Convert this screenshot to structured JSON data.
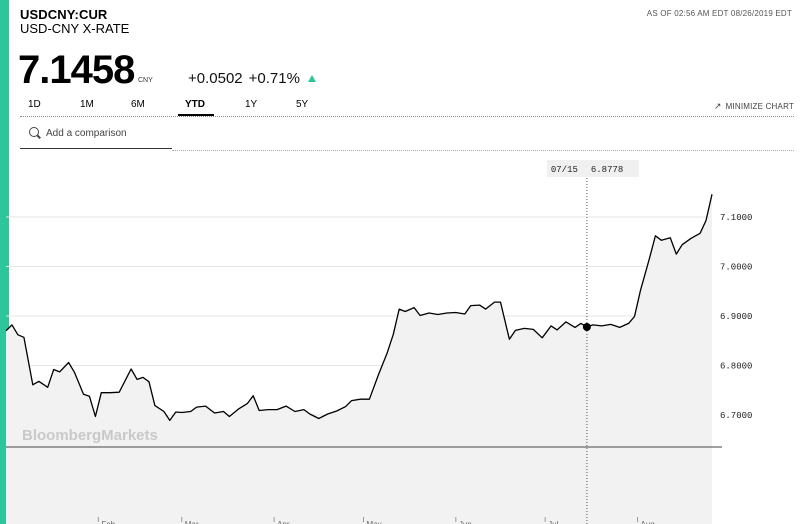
{
  "header": {
    "ticker": "USDCNY:CUR",
    "name": "USD-CNY X-RATE",
    "as_of": "AS OF 02:56 AM EDT 08/26/2019 EDT"
  },
  "quote": {
    "price": "7.1458",
    "currency": "CNY",
    "change": "+0.0502",
    "change_pct": "+0.71%"
  },
  "tabs": [
    {
      "label": "1D",
      "active": false
    },
    {
      "label": "1M",
      "active": false
    },
    {
      "label": "6M",
      "active": false
    },
    {
      "label": "YTD",
      "active": true
    },
    {
      "label": "1Y",
      "active": false
    },
    {
      "label": "5Y",
      "active": false
    }
  ],
  "minimize_label": "MINIMIZE CHART",
  "search": {
    "placeholder": "Add a comparison"
  },
  "watermark": "BloombergMarkets",
  "colors": {
    "accent": "#2ec59b",
    "line": "#000000",
    "fill": "#f2f2f2"
  },
  "chart_data": {
    "type": "area",
    "y_ticks": [
      "7.1000",
      "7.0000",
      "6.9000",
      "6.8000",
      "6.7000"
    ],
    "y_tick_values": [
      7.1,
      7.0,
      6.9,
      6.8,
      6.7
    ],
    "ylim": [
      6.6371,
      7.1864
    ],
    "x_tick_labels": [
      "Feb",
      "Mar",
      "Apr",
      "May",
      "Jun",
      "Jul",
      "Aug"
    ],
    "x_range": [
      "2019-01-01",
      "2019-08-26"
    ],
    "grid": true,
    "crosshair": {
      "x": "2019-07-15",
      "label_date": "07/15",
      "label_value": "6.8778",
      "value": 6.8778
    },
    "series": [
      {
        "values": [
          [
            "2019-01-01",
            6.87
          ],
          [
            "2019-01-03",
            6.882
          ],
          [
            "2019-01-05",
            6.862
          ],
          [
            "2019-01-07",
            6.857
          ],
          [
            "2019-01-10",
            6.761
          ],
          [
            "2019-01-12",
            6.768
          ],
          [
            "2019-01-15",
            6.756
          ],
          [
            "2019-01-17",
            6.792
          ],
          [
            "2019-01-19",
            6.787
          ],
          [
            "2019-01-22",
            6.806
          ],
          [
            "2019-01-24",
            6.786
          ],
          [
            "2019-01-27",
            6.742
          ],
          [
            "2019-01-29",
            6.738
          ],
          [
            "2019-01-31",
            6.697
          ],
          [
            "2019-02-02",
            6.745
          ],
          [
            "2019-02-05",
            6.745
          ],
          [
            "2019-02-08",
            6.746
          ],
          [
            "2019-02-12",
            6.793
          ],
          [
            "2019-02-14",
            6.772
          ],
          [
            "2019-02-16",
            6.776
          ],
          [
            "2019-02-18",
            6.767
          ],
          [
            "2019-02-20",
            6.719
          ],
          [
            "2019-02-23",
            6.707
          ],
          [
            "2019-02-25",
            6.689
          ],
          [
            "2019-02-27",
            6.706
          ],
          [
            "2019-03-01",
            6.705
          ],
          [
            "2019-03-04",
            6.707
          ],
          [
            "2019-03-06",
            6.716
          ],
          [
            "2019-03-09",
            6.718
          ],
          [
            "2019-03-12",
            6.704
          ],
          [
            "2019-03-15",
            6.707
          ],
          [
            "2019-03-17",
            6.697
          ],
          [
            "2019-03-20",
            6.712
          ],
          [
            "2019-03-23",
            6.723
          ],
          [
            "2019-03-25",
            6.739
          ],
          [
            "2019-03-27",
            6.709
          ],
          [
            "2019-03-30",
            6.711
          ],
          [
            "2019-04-02",
            6.711
          ],
          [
            "2019-04-05",
            6.718
          ],
          [
            "2019-04-08",
            6.707
          ],
          [
            "2019-04-11",
            6.711
          ],
          [
            "2019-04-13",
            6.702
          ],
          [
            "2019-04-16",
            6.693
          ],
          [
            "2019-04-19",
            6.702
          ],
          [
            "2019-04-22",
            6.708
          ],
          [
            "2019-04-25",
            6.717
          ],
          [
            "2019-04-27",
            6.729
          ],
          [
            "2019-04-30",
            6.732
          ],
          [
            "2019-05-03",
            6.732
          ],
          [
            "2019-05-06",
            6.781
          ],
          [
            "2019-05-09",
            6.826
          ],
          [
            "2019-05-11",
            6.863
          ],
          [
            "2019-05-13",
            6.914
          ],
          [
            "2019-05-15",
            6.909
          ],
          [
            "2019-05-18",
            6.917
          ],
          [
            "2019-05-20",
            6.901
          ],
          [
            "2019-05-23",
            6.906
          ],
          [
            "2019-05-26",
            6.903
          ],
          [
            "2019-05-29",
            6.906
          ],
          [
            "2019-06-01",
            6.907
          ],
          [
            "2019-06-04",
            6.904
          ],
          [
            "2019-06-06",
            6.921
          ],
          [
            "2019-06-09",
            6.922
          ],
          [
            "2019-06-11",
            6.914
          ],
          [
            "2019-06-14",
            6.928
          ],
          [
            "2019-06-16",
            6.928
          ],
          [
            "2019-06-19",
            6.853
          ],
          [
            "2019-06-21",
            6.871
          ],
          [
            "2019-06-24",
            6.875
          ],
          [
            "2019-06-27",
            6.873
          ],
          [
            "2019-06-30",
            6.856
          ],
          [
            "2019-07-03",
            6.88
          ],
          [
            "2019-07-05",
            6.872
          ],
          [
            "2019-07-08",
            6.888
          ],
          [
            "2019-07-11",
            6.877
          ],
          [
            "2019-07-13",
            6.885
          ],
          [
            "2019-07-15",
            6.8778
          ],
          [
            "2019-07-17",
            6.882
          ],
          [
            "2019-07-20",
            6.88
          ],
          [
            "2019-07-23",
            6.883
          ],
          [
            "2019-07-26",
            6.877
          ],
          [
            "2019-07-29",
            6.885
          ],
          [
            "2019-07-31",
            6.899
          ],
          [
            "2019-08-02",
            6.952
          ],
          [
            "2019-08-05",
            7.016
          ],
          [
            "2019-08-07",
            7.062
          ],
          [
            "2019-08-09",
            7.053
          ],
          [
            "2019-08-12",
            7.058
          ],
          [
            "2019-08-14",
            7.025
          ],
          [
            "2019-08-16",
            7.044
          ],
          [
            "2019-08-19",
            7.057
          ],
          [
            "2019-08-22",
            7.067
          ],
          [
            "2019-08-24",
            7.093
          ],
          [
            "2019-08-26",
            7.1458
          ]
        ]
      }
    ]
  }
}
